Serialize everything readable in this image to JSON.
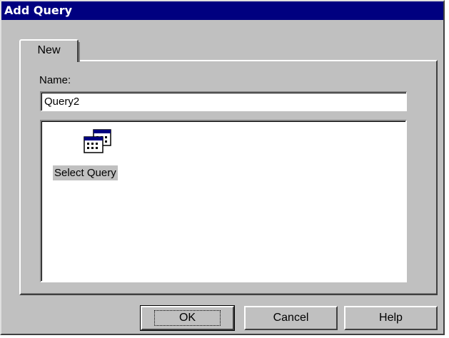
{
  "window": {
    "title": "Add Query"
  },
  "tabs": [
    {
      "label": "New"
    }
  ],
  "form": {
    "name_label": "Name:",
    "name_value": "Query2"
  },
  "list": {
    "items": [
      {
        "label": "Select Query",
        "icon": "select-query-icon"
      }
    ]
  },
  "buttons": {
    "ok": "OK",
    "cancel": "Cancel",
    "help": "Help"
  },
  "colors": {
    "titlebar": "#000080",
    "face": "#c0c0c0",
    "selection": "#c0c0c0"
  }
}
